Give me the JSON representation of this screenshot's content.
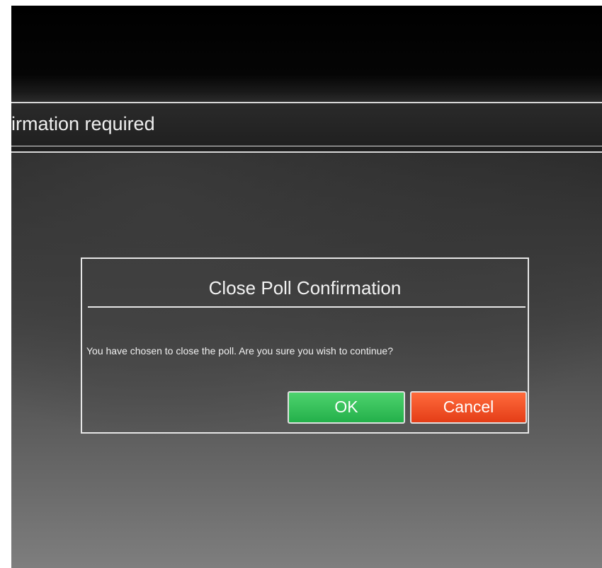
{
  "window": {
    "title_partial": "irmation required"
  },
  "dialog": {
    "title": "Close Poll Confirmation",
    "message": "You have chosen to close the poll. Are you sure you wish to continue?",
    "buttons": {
      "ok_label": "OK",
      "cancel_label": "Cancel"
    }
  },
  "colors": {
    "ok_button": "#2fbf55",
    "cancel_button": "#f04f24",
    "dialog_border": "#e6e6e6",
    "background": "#3a3a3a"
  }
}
